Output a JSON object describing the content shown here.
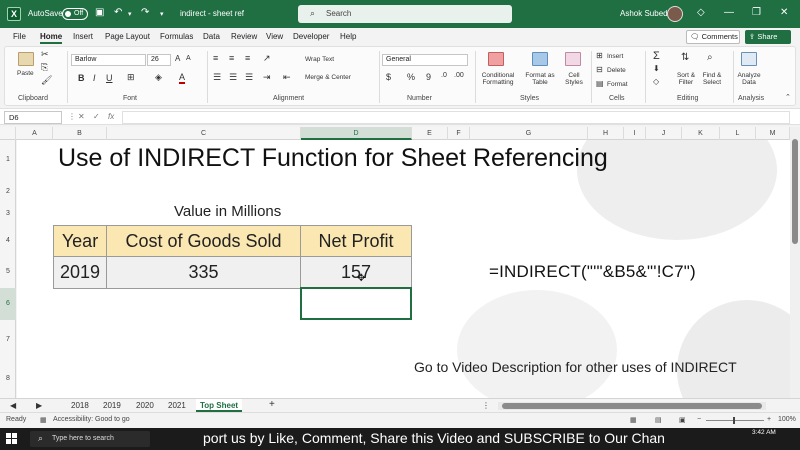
{
  "titlebar": {
    "autosave_label": "AutoSave",
    "autosave_state": "Off",
    "document_name": "indirect - sheet ref",
    "search_placeholder": "Search",
    "user_name": "Ashok Subedi"
  },
  "menu": {
    "tabs": [
      "File",
      "Home",
      "Insert",
      "Page Layout",
      "Formulas",
      "Data",
      "Review",
      "View",
      "Developer",
      "Help"
    ],
    "active_tab": "Home",
    "comments_label": "Comments",
    "share_label": "Share"
  },
  "ribbon": {
    "clipboard": {
      "paste": "Paste",
      "label": "Clipboard"
    },
    "font": {
      "name": "Barlow",
      "size": "26",
      "bold": "B",
      "italic": "I",
      "underline": "U",
      "label": "Font"
    },
    "alignment": {
      "wrap": "Wrap Text",
      "merge": "Merge & Center",
      "label": "Alignment"
    },
    "number": {
      "format": "General",
      "currency": "$",
      "percent": "%",
      "comma": "9",
      "label": "Number"
    },
    "styles": {
      "conditional": "Conditional Formatting",
      "format_table": "Format as Table",
      "cell_styles": "Cell Styles",
      "label": "Styles"
    },
    "cells": {
      "insert": "Insert",
      "delete": "Delete",
      "format": "Format",
      "label": "Cells"
    },
    "editing": {
      "sum": "Σ",
      "sort": "Sort & Filter",
      "find": "Find & Select",
      "label": "Editing"
    },
    "analysis": {
      "analyze": "Analyze Data",
      "label": "Analysis"
    }
  },
  "formula_bar": {
    "name_box": "D6",
    "fx": "fx",
    "content": ""
  },
  "columns": [
    "A",
    "B",
    "C",
    "D",
    "E",
    "F",
    "G",
    "H",
    "I",
    "J",
    "K",
    "L",
    "M"
  ],
  "rows": [
    "1",
    "2",
    "3",
    "4",
    "5",
    "6",
    "7",
    "8"
  ],
  "sheet": {
    "title": "Use of INDIRECT Function for Sheet Referencing",
    "subtitle": "Value in Millions",
    "table": {
      "headers": [
        "Year",
        "Cost of Goods Sold",
        "Net Profit"
      ],
      "row": [
        "2019",
        "335",
        "157"
      ]
    },
    "formula_display": "=INDIRECT(\"'\"&B5&\"'!C7\")",
    "note": "Go to Video Description for other uses of INDIRECT"
  },
  "sheet_tabs": [
    "2018",
    "2019",
    "2020",
    "2021",
    "Top Sheet"
  ],
  "active_sheet": "Top Sheet",
  "add_sheet": "+",
  "status": {
    "ready": "Ready",
    "accessibility": "Accessibility: Good to go",
    "zoom": "100%"
  },
  "taskbar": {
    "search_placeholder": "Type here to search",
    "banner": "port us by Like, Comment, Share this Video and SUBSCRIBE to Our Chan",
    "time": "3:42 AM"
  },
  "colors": {
    "accent": "#1f6f43",
    "header_fill": "#fbe7b2",
    "value_fill": "#f0f0f0"
  }
}
